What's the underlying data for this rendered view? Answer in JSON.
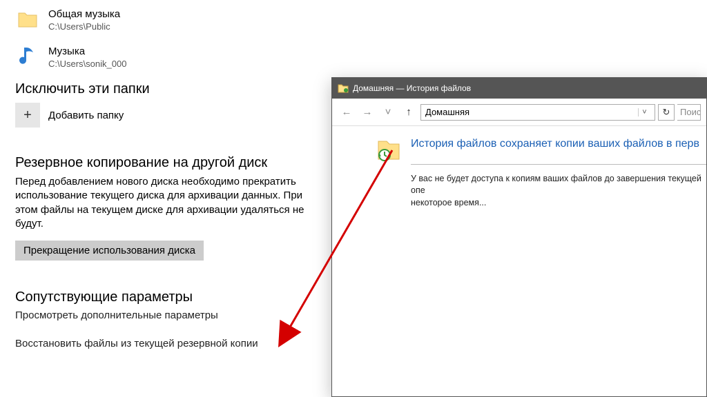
{
  "folders": [
    {
      "title": "Общая музыка",
      "path": "C:\\Users\\Public",
      "icon": "folder"
    },
    {
      "title": "Музыка",
      "path": "C:\\Users\\sonik_000",
      "icon": "music"
    }
  ],
  "exclude": {
    "heading": "Исключить эти папки",
    "add_label": "Добавить папку",
    "plus": "+"
  },
  "backup": {
    "heading": "Резервное копирование на другой диск",
    "desc": "Перед добавлением нового диска необходимо прекратить использование текущего диска для архивации данных. При этом файлы на текущем диске для архивации удаляться не будут.",
    "button": "Прекращение использования диска"
  },
  "related": {
    "heading": "Сопутствующие параметры",
    "link1": "Просмотреть дополнительные параметры",
    "link2": "Восстановить файлы из текущей резервной копии"
  },
  "popup": {
    "title": "Домашняя — История файлов",
    "address": "Домашняя",
    "search_placeholder": "Поис",
    "main_title": "История файлов сохраняет копии ваших файлов в перв",
    "main_desc": "У вас не будет доступа к копиям ваших файлов до завершения текущей опе\nнекоторое время...",
    "nav": {
      "back": "←",
      "forward": "→",
      "up": "↑",
      "chevron": "˅",
      "refresh": "↻"
    }
  }
}
